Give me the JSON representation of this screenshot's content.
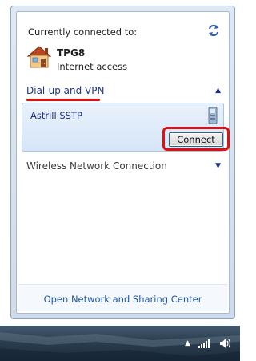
{
  "header": {
    "connected_label": "Currently connected to:",
    "network_name": "TPG8",
    "network_status": "Internet access"
  },
  "sections": {
    "dialup": {
      "label": "Dial-up and VPN",
      "expanded": true,
      "items": [
        {
          "name": "Astrill SSTP",
          "button_label": "Connect",
          "button_access_key": "C"
        }
      ]
    },
    "wireless": {
      "label": "Wireless Network Connection",
      "expanded": false
    }
  },
  "footer": {
    "link_label": "Open Network and Sharing Center"
  },
  "icons": {
    "refresh": "refresh-icon",
    "house": "house-network-icon",
    "vpn": "vpn-connection-icon",
    "tray_arrow": "show-hidden-icons-icon",
    "tray_signal": "network-signal-icon",
    "tray_volume": "speaker-volume-icon"
  },
  "colors": {
    "accent_blue": "#1e3287",
    "link_blue": "#1e56a6",
    "annotation_red": "#e01010",
    "selection_bg": "#d6e6f8"
  }
}
